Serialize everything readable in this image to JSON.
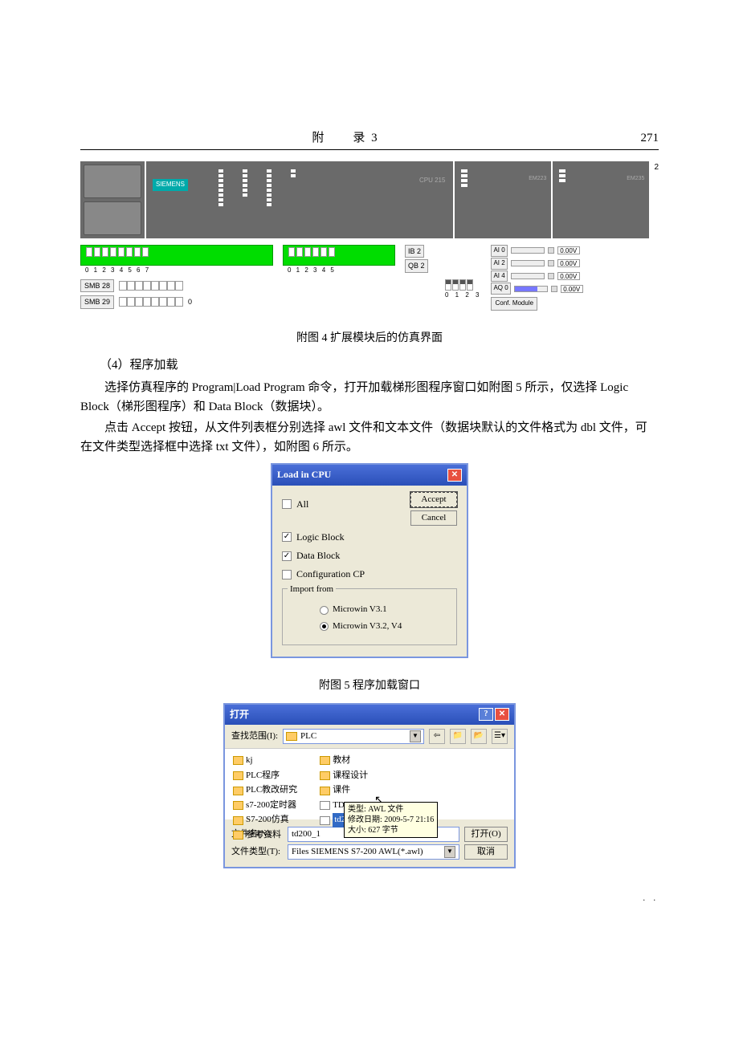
{
  "header": {
    "center": "附　　录 3",
    "page": "271"
  },
  "sim": {
    "siemens": "SIEMENS",
    "cpu_label": "CPU 215",
    "mod1_label": "EM223",
    "mod2_label": "EM235",
    "io_nums1": "0 1 2 3 4 5 6 7",
    "io_nums2": "0 1 2 3 4 5",
    "ib2": "IB 2",
    "qb2": "QB 2",
    "dip_nums": "0 1 2 3",
    "smb28": "SMB 28",
    "smb29": "SMB 29",
    "smb29_val": "0",
    "ai0": "AI 0",
    "ai2": "AI 2",
    "ai4": "AI 4",
    "aq0": "AQ 0",
    "ai_val": "0.00V",
    "conf_module": "Conf. Module",
    "index2": "2"
  },
  "captions": {
    "fig4": "附图 4  扩展模块后的仿真界面",
    "fig5": "附图 5  程序加载窗口"
  },
  "text": {
    "s4": "（4）程序加载",
    "p1": "选择仿真程序的 Program|Load Program 命令，打开加载梯形图程序窗口如附图 5 所示，仅选择 Logic Block（梯形图程序）和 Data Block（数据块）。",
    "p2": "点击 Accept 按钮，从文件列表框分别选择 awl 文件和文本文件（数据块默认的文件格式为 dbl 文件，可在文件类型选择框中选择 txt 文件），如附图 6 所示。"
  },
  "dlg": {
    "title": "Load in CPU",
    "all": "All",
    "logic": "Logic Block",
    "data": "Data Block",
    "conf": "Configuration CP",
    "accept": "Accept",
    "cancel": "Cancel",
    "import": "Import from",
    "r1": "Microwin V3.1",
    "r2": "Microwin V3.2, V4"
  },
  "fdlg": {
    "title": "打开",
    "lookin_label": "查找范围(I):",
    "lookin_value": "PLC",
    "col1": [
      "kj",
      "PLC程序",
      "PLC教改研究",
      "s7-200定时器",
      "S7-200仿真",
      "参考资料"
    ],
    "col2_folders": [
      "教材",
      "课程设计",
      "课件"
    ],
    "col2_files": [
      "TD200.awl",
      "td200_1.awl"
    ],
    "tooltip_l1": "类型: AWL 文件",
    "tooltip_l2": "修改日期: 2009-5-7 21:16",
    "tooltip_l3": "大小: 627 字节",
    "fn_label": "文件名(N):",
    "fn_value": "td200_1",
    "ft_label": "文件类型(T):",
    "ft_value": "Files SIEMENS S7-200 AWL(*.awl)",
    "open": "打开(O)",
    "cancel": "取消"
  },
  "dots": ". ."
}
